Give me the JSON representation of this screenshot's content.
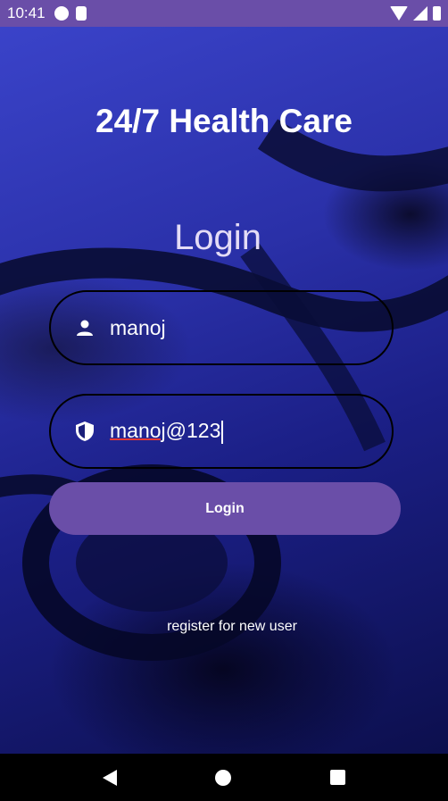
{
  "status_bar": {
    "time": "10:41",
    "icons": [
      "privacy-indicator-icon",
      "sd-card-icon",
      "wifi-icon",
      "signal-icon",
      "battery-icon"
    ]
  },
  "app": {
    "title": "24/7 Health Care",
    "heading": "Login"
  },
  "form": {
    "username": {
      "icon": "person-icon",
      "value": "manoj"
    },
    "password": {
      "icon": "shield-icon",
      "value_underlined": "manoj",
      "value_rest": "@123"
    },
    "login_button_label": "Login",
    "register_link_label": "register for new user"
  },
  "navigation": {
    "icons": [
      "back-icon",
      "home-icon",
      "recents-icon"
    ]
  },
  "colors": {
    "primary": "#6a4ea8",
    "background": "#1a1f7a",
    "heading": "#e4dcf6"
  }
}
